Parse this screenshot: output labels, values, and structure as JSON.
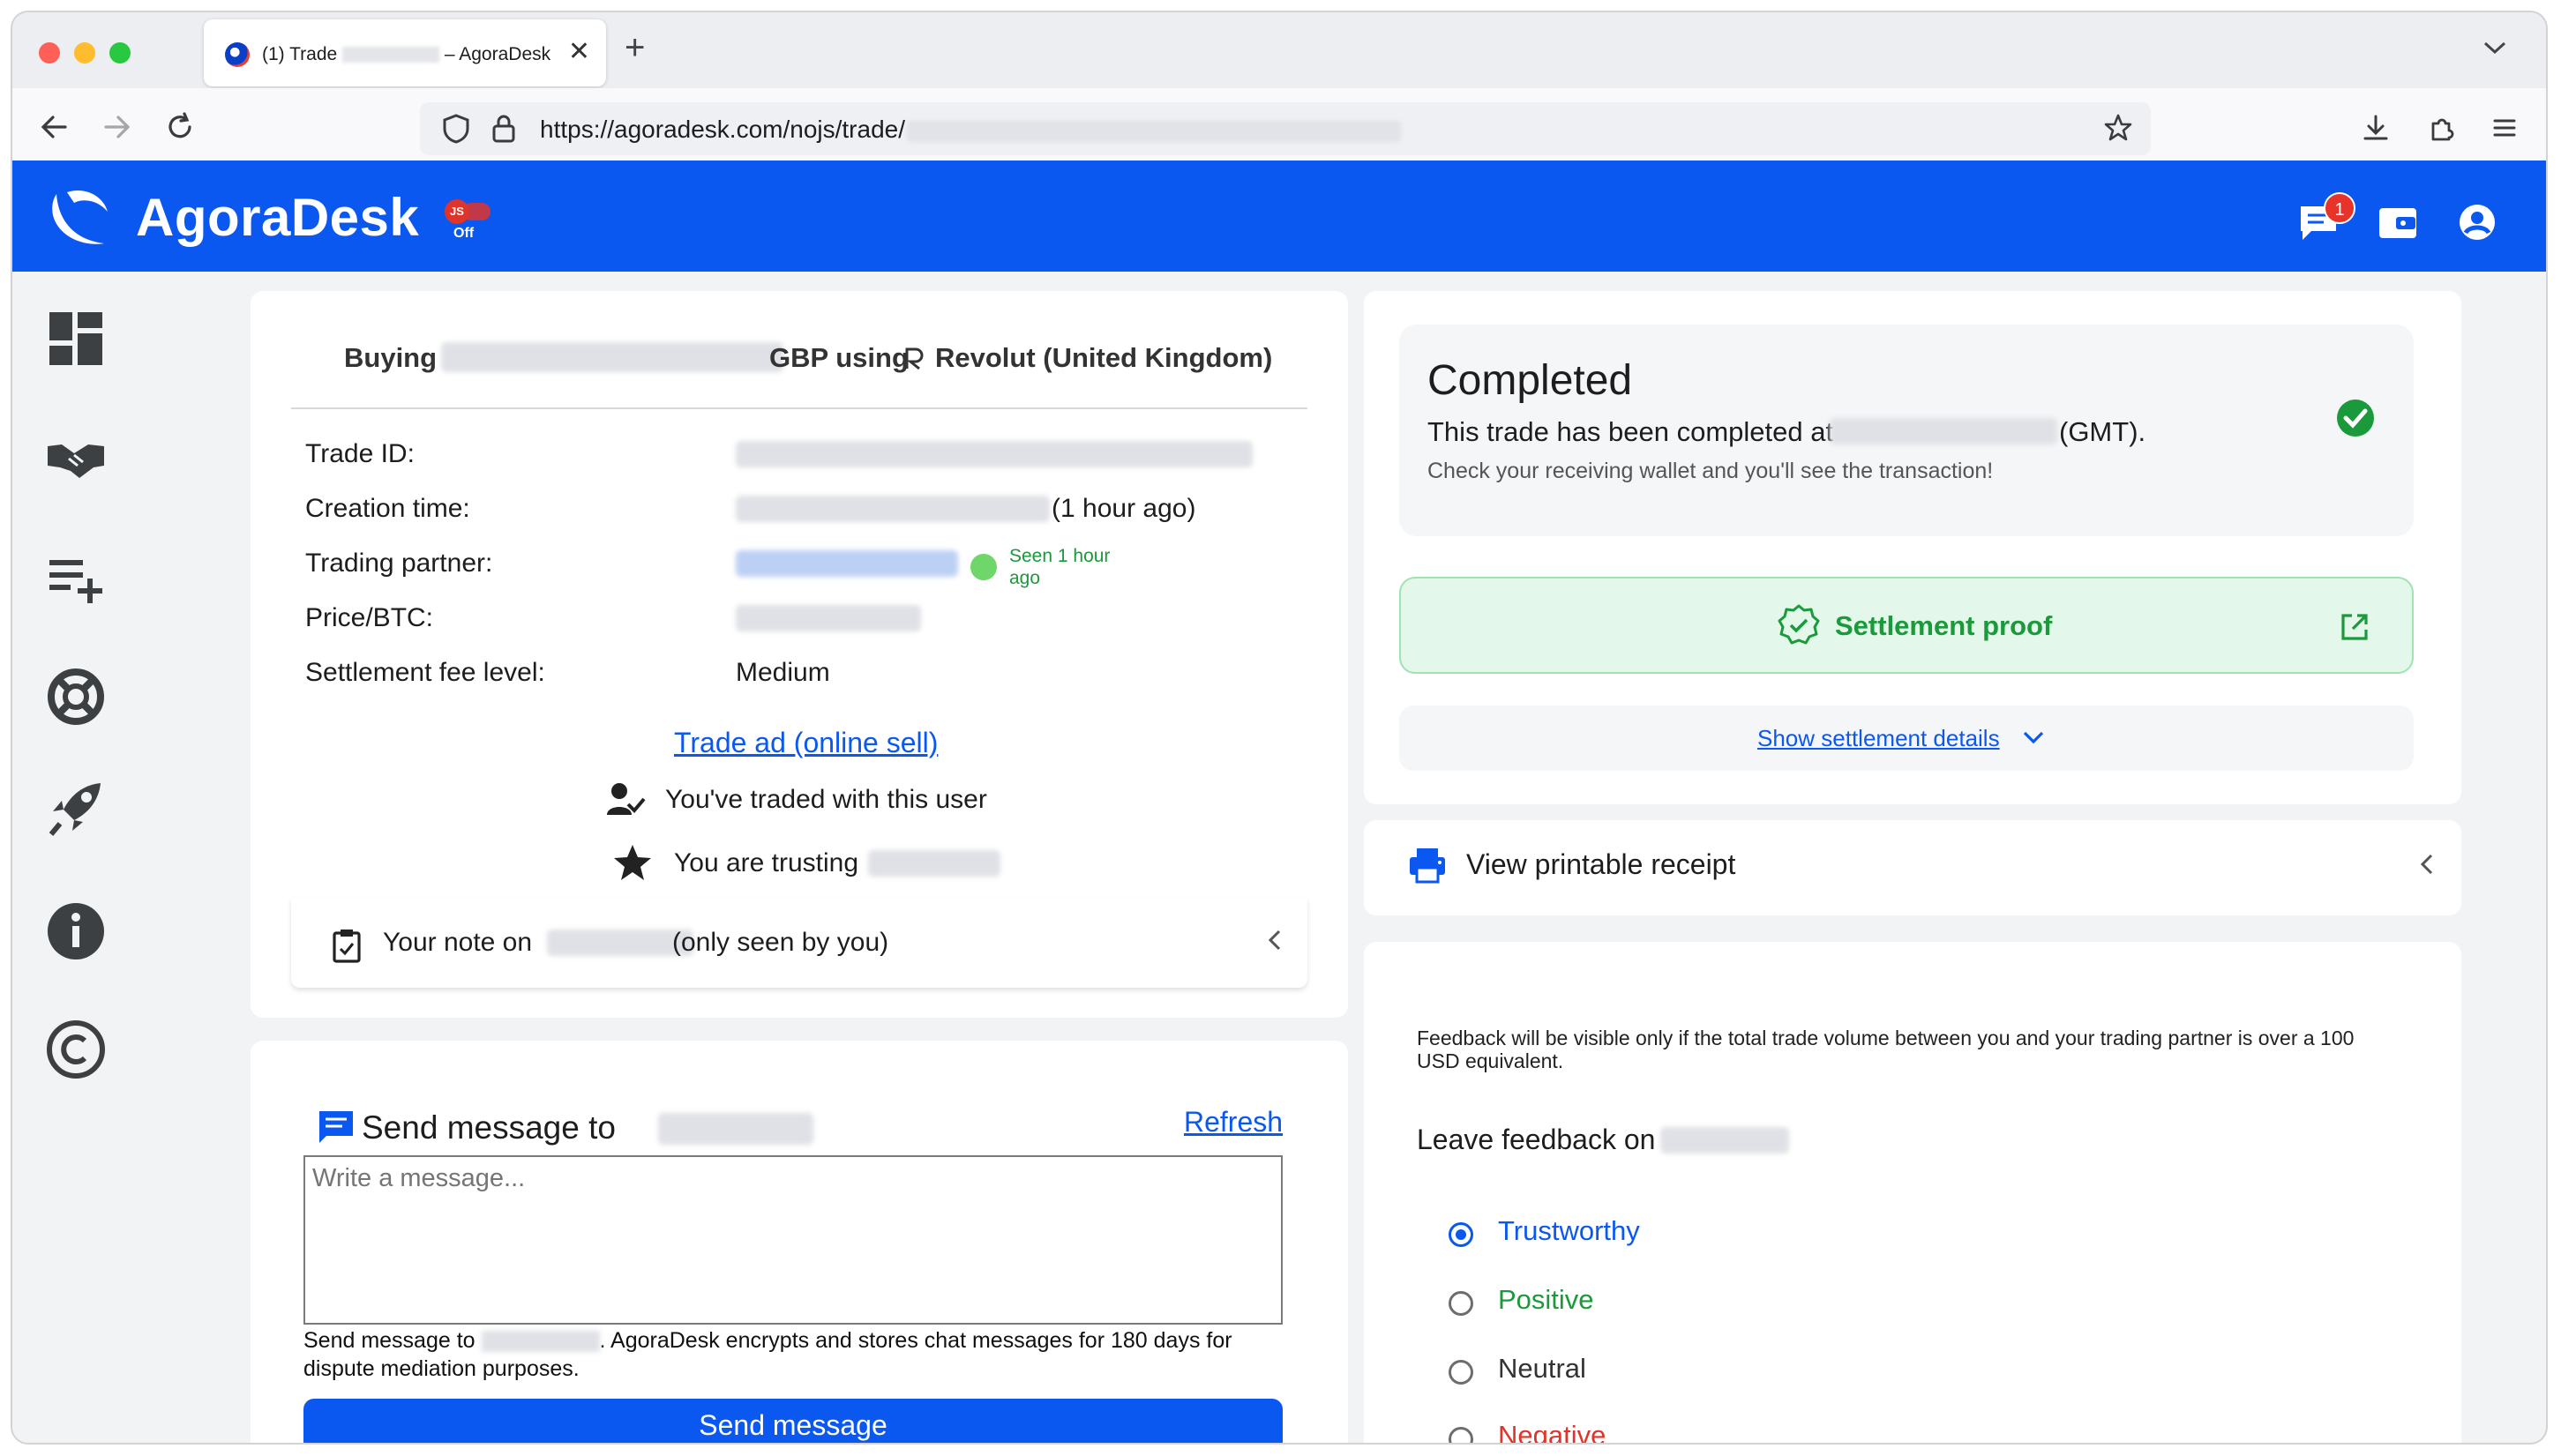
{
  "browser": {
    "tab_title": "(1) Trade",
    "tab_title_suffix": "– AgoraDesk",
    "url_prefix": "https://agoradesk.com/nojs/trade/"
  },
  "header": {
    "brand": "AgoraDesk",
    "js_label": "JS",
    "js_state": "Off",
    "notifications_count": "1",
    "accent_color": "#0b58f0"
  },
  "trade": {
    "buying_label": "Buying",
    "currency_using": "GBP using",
    "payment_method": "Revolut (United Kingdom)",
    "fields": {
      "trade_id_label": "Trade ID:",
      "creation_time_label": "Creation time:",
      "creation_time_relative": "(1 hour ago)",
      "trading_partner_label": "Trading partner:",
      "seen_text": "Seen 1 hour ago",
      "price_label": "Price/BTC:",
      "fee_label": "Settlement fee level:",
      "fee_value": "Medium"
    },
    "trade_ad_link": "Trade ad (online sell)",
    "traded_with_user": "You've traded with this user",
    "trusting_prefix": "You are trusting",
    "note_prefix": "Your note on",
    "note_suffix": "(only seen by you)"
  },
  "message": {
    "title_prefix": "Send message to",
    "refresh": "Refresh",
    "placeholder": "Write a message...",
    "hint_prefix": "Send message to",
    "hint_text": ". AgoraDesk encrypts and stores chat messages for 180 days for dispute mediation purposes.",
    "send_button": "Send message"
  },
  "status": {
    "title": "Completed",
    "completed_prefix": "This trade has been completed at",
    "completed_suffix": "(GMT).",
    "subtext": "Check your receiving wallet and you'll see the transaction!",
    "settlement_proof": "Settlement proof",
    "show_details": "Show settlement details",
    "success_color": "#1a9a3a"
  },
  "receipt": {
    "label": "View printable receipt"
  },
  "feedback": {
    "notice": "Feedback will be visible only if the total trade volume between you and your trading partner is over a 100 USD equivalent.",
    "leave_prefix": "Leave feedback on",
    "options": [
      {
        "label": "Trustworthy",
        "color": "#0b58f0",
        "selected": true
      },
      {
        "label": "Positive",
        "color": "#1a9a3a",
        "selected": false
      },
      {
        "label": "Neutral",
        "color": "#333333",
        "selected": false
      },
      {
        "label": "Negative",
        "color": "#e0342a",
        "selected": false
      }
    ]
  }
}
